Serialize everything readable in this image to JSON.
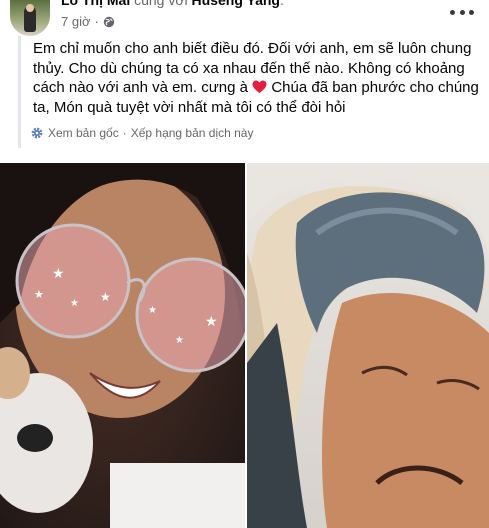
{
  "post": {
    "author": "Lò Thị Mai",
    "with_text": "cùng với",
    "tagged": "Huseng Yang",
    "time": "7 giờ",
    "time_separator": "·",
    "privacy_icon": "globe-icon",
    "text_part1": "Em chỉ muốn cho anh biết điều đó. Đối với anh, em sẽ luôn chung thủy. Cho dù chúng ta có xa nhau đến thế nào. Không có khoảng cách nào với anh và em. cưng à",
    "emoji": "heart-icon",
    "text_part2": " Chúa đã ban phước cho chúng ta, Món quà tuyệt vời nhất mà tôi có thể đòi hỏi"
  },
  "translation": {
    "icon": "gear-icon",
    "see_original": "Xem bản gốc",
    "separator": "·",
    "rate": "Xếp hạng bản dịch này"
  },
  "colors": {
    "heart": "#e41e3f",
    "text": "#050505",
    "secondary": "#65676b"
  }
}
